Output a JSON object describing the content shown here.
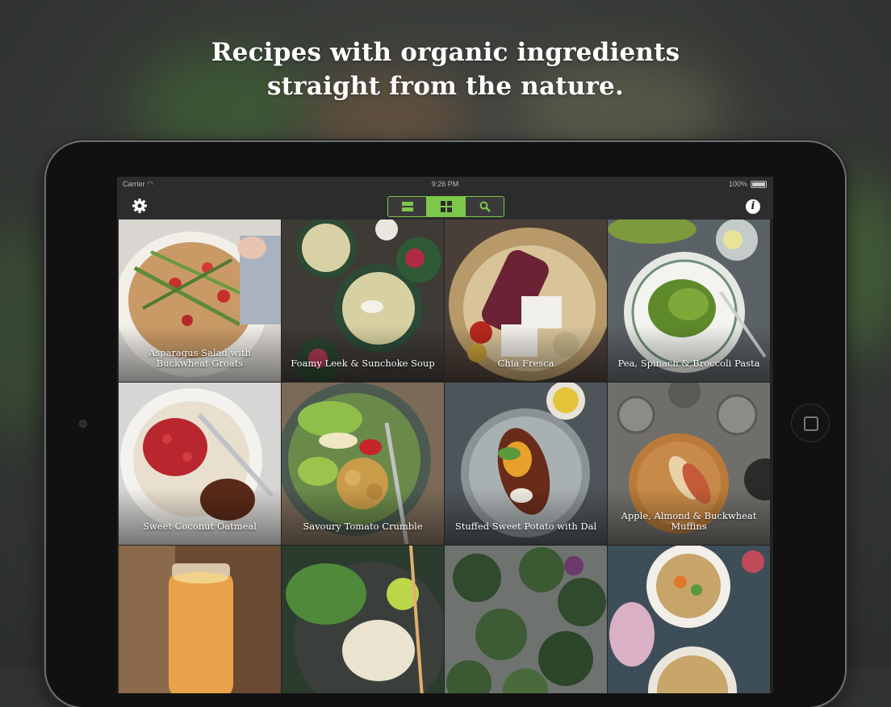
{
  "headline": {
    "line1": "Recipes with organic ingredients",
    "line2": "straight from the nature."
  },
  "statusbar": {
    "carrier": "Carrier",
    "time": "9:26 PM",
    "battery": "100%"
  },
  "toolbar": {
    "settings_icon": "gear-icon",
    "segments": [
      {
        "icon": "list-view-icon",
        "active": false
      },
      {
        "icon": "grid-view-icon",
        "active": true
      },
      {
        "icon": "search-icon",
        "active": false
      }
    ],
    "info_label": "i"
  },
  "colors": {
    "accent": "#7cc84a",
    "bar": "#2c2c2c"
  },
  "recipes": [
    {
      "title": "Asparagus Salad with Buckwheat Groats"
    },
    {
      "title": "Foamy Leek & Sunchoke Soup"
    },
    {
      "title": "Chia Fresca"
    },
    {
      "title": "Pea, Spinach & Broccoli Pasta"
    },
    {
      "title": "Sweet Coconut Oatmeal"
    },
    {
      "title": "Savoury Tomato Crumble"
    },
    {
      "title": "Stuffed Sweet Potato with Dal"
    },
    {
      "title": "Apple, Almond & Buckwheat Muffins"
    },
    {
      "title": ""
    },
    {
      "title": ""
    },
    {
      "title": ""
    },
    {
      "title": ""
    }
  ]
}
